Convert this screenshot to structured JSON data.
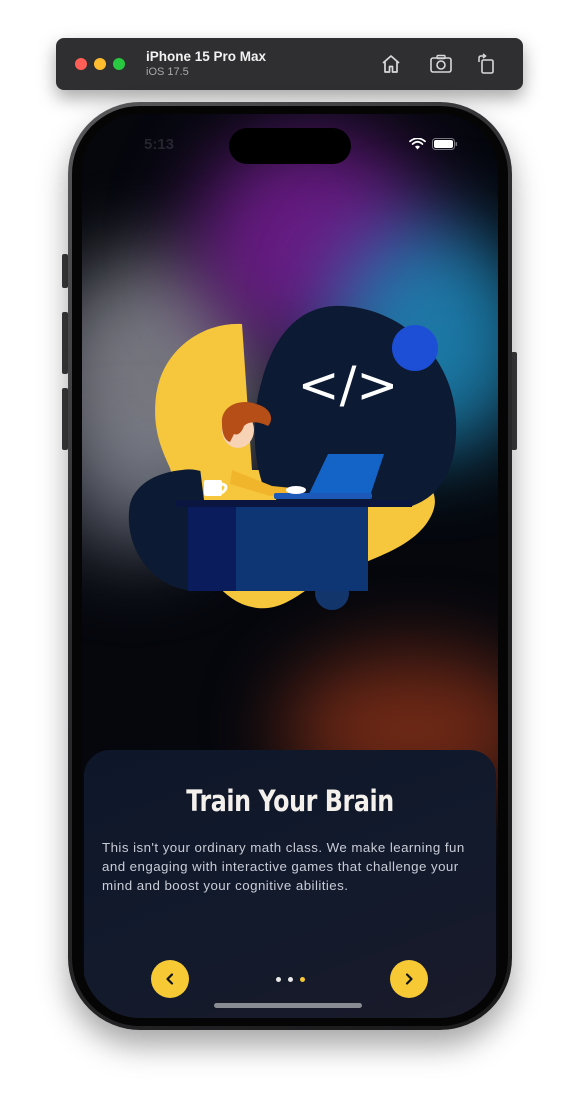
{
  "simulator": {
    "device_name": "iPhone 15 Pro Max",
    "os_version": "iOS 17.5",
    "toolbar_icons": [
      "home-icon",
      "screenshot-icon",
      "rotate-icon"
    ]
  },
  "status_bar": {
    "time": "5:13",
    "icons": [
      "wifi-icon",
      "battery-icon"
    ]
  },
  "onboarding": {
    "title": "Train Your Brain",
    "description": "This isn't your ordinary math class. We make learning fun and engaging with interactive games that challenge your mind and boost your cognitive abilities.",
    "code_symbol": "</>",
    "page_indicator": {
      "total": 3,
      "current": 3
    },
    "prev_icon": "chevron-left-icon",
    "next_icon": "chevron-right-icon"
  },
  "colors": {
    "accent_yellow": "#f6c935",
    "card_background": "#0e1729",
    "blob_dark": "#0c1a33",
    "blue_dot": "#1d4fd6"
  }
}
